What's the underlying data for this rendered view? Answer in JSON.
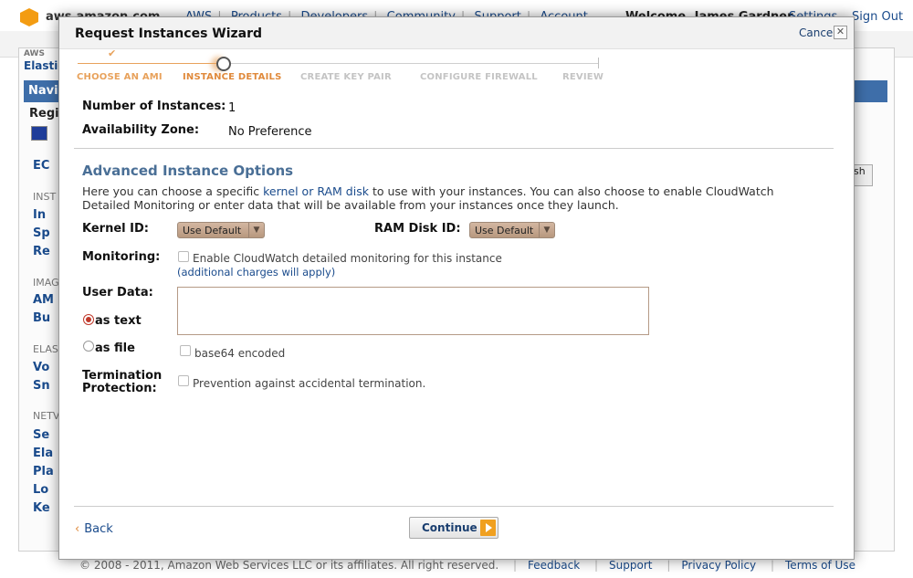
{
  "background": {
    "domain": "aws.amazon.com",
    "top_links": [
      "AWS",
      "Products",
      "Developers",
      "Community",
      "Support",
      "Account"
    ],
    "welcome": "Welcome, James Gardner",
    "settings": "Settings",
    "sign_out": "Sign Out",
    "aws_small": "AWS",
    "elastic": "Elastic",
    "nav_head": "Navi",
    "region_label": "Regio",
    "nav_items": [
      {
        "text": "EC",
        "type": "item"
      },
      {
        "text": "INST",
        "type": "head"
      },
      {
        "text": "In",
        "type": "item"
      },
      {
        "text": "Sp",
        "type": "item"
      },
      {
        "text": "Re",
        "type": "item"
      },
      {
        "text": "IMAG",
        "type": "head"
      },
      {
        "text": "AM",
        "type": "item"
      },
      {
        "text": "Bu",
        "type": "item"
      },
      {
        "text": "ELAS",
        "type": "head"
      },
      {
        "text": "Vo",
        "type": "item"
      },
      {
        "text": "Sn",
        "type": "item"
      },
      {
        "text": "NETV",
        "type": "head"
      },
      {
        "text": "Se",
        "type": "item"
      },
      {
        "text": "Ela",
        "type": "item"
      },
      {
        "text": "Pla",
        "type": "item"
      },
      {
        "text": "Lo",
        "type": "item"
      },
      {
        "text": "Ke",
        "type": "item"
      }
    ],
    "right_btn": "sh",
    "footer": {
      "copyright": "© 2008 - 2011, Amazon Web Services LLC or its affiliates. All right reserved.",
      "links": [
        "Feedback",
        "Support",
        "Privacy Policy",
        "Terms of Use"
      ]
    }
  },
  "wizard": {
    "title": "Request Instances Wizard",
    "cancel": "Cancel",
    "close": "✕",
    "steps": [
      {
        "label": "CHOOSE AN AMI",
        "state": "done"
      },
      {
        "label": "INSTANCE DETAILS",
        "state": "current"
      },
      {
        "label": "CREATE KEY PAIR",
        "state": "todo"
      },
      {
        "label": "CONFIGURE FIREWALL",
        "state": "todo"
      },
      {
        "label": "REVIEW",
        "state": "todo"
      }
    ],
    "check": "✔",
    "num_instances_label": "Number of Instances:",
    "num_instances_value": "1",
    "az_label": "Availability Zone:",
    "az_value": "No Preference",
    "advanced_title": "Advanced Instance Options",
    "help_pre": "Here you can choose a specific ",
    "help_link": "kernel or RAM disk",
    "help_post": " to use with your instances. You can also choose to enable CloudWatch Detailed Monitoring or enter data that will be available from your instances once they launch.",
    "kernel_label": "Kernel ID:",
    "kernel_value": "Use Default",
    "ramdisk_label": "RAM Disk ID:",
    "ramdisk_value": "Use Default",
    "monitoring_label": "Monitoring:",
    "monitoring_text": "Enable CloudWatch detailed monitoring for this instance",
    "monitoring_charges": "(additional charges will apply)",
    "userdata_label": "User Data:",
    "as_text": "as text",
    "as_file": "as file",
    "base64": "base64 encoded",
    "termination_label_1": "Termination",
    "termination_label_2": "Protection:",
    "termination_text": "Prevention against accidental termination.",
    "back": "Back",
    "back_chevron": "‹",
    "continue": "Continue",
    "dropdown_arrow": "▼"
  }
}
